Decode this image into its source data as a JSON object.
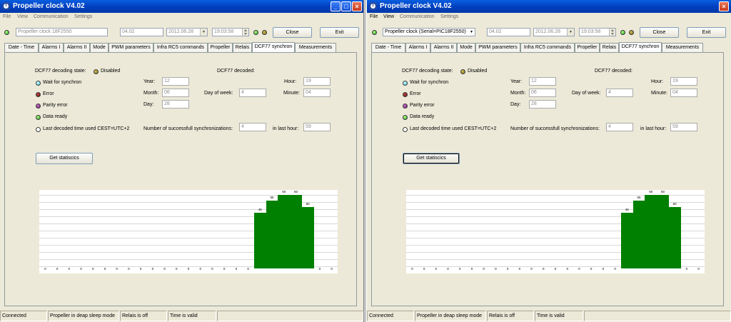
{
  "windows": [
    {
      "title": "Propeller clock V4.02",
      "menu": {
        "file": "File",
        "view": "View",
        "communication": "Communication",
        "settings": "Settings"
      },
      "device": "Propeller clock 18F2550",
      "device_is_dropdown": false,
      "version": "04.02",
      "date": "2012.06.28",
      "time": "19:03:58",
      "close_label": "Close",
      "exit_label": "Exit",
      "tabs": [
        "Date - Time",
        "Alarms I",
        "Alarms II",
        "Mode",
        "PWM parameters",
        "Infra RC5 commands",
        "Propeller",
        "Relais",
        "DCF77 synchron",
        "Measurements"
      ],
      "selected_tab": 8,
      "dcf": {
        "state_label": "DCF77 decoding state:",
        "state_value": "Disabled",
        "decoded_label": "DCF77 decoded:",
        "legend": [
          "Wait for synchron",
          "Error",
          "Parity error",
          "Data ready",
          "Last decoded time used CEST=UTC+2"
        ],
        "year_label": "Year:",
        "year": "12",
        "month_label": "Month:",
        "month": "06",
        "day_label": "Day:",
        "day": "28",
        "dow_label": "Day of week:",
        "dow": "4",
        "hour_label": "Hour:",
        "hour": "19",
        "minute_label": "Minute:",
        "minute": "04",
        "sync_label": "Number of successfull synchronizations:",
        "sync": "4",
        "last_hour_label": "in last hour:",
        "last_hour": "59",
        "stats_button": "Get statiscics",
        "stats_focused": false
      },
      "status": [
        "Connected",
        "Propeller in deap sleep mode",
        "Relais is off",
        "Time is valid"
      ]
    },
    {
      "title": "Propeller clock V4.02",
      "menu": {
        "file": "File",
        "view": "View",
        "communication": "Communication",
        "settings": "Settings"
      },
      "device": "Propeller clock (Serial=PIC18F2550)",
      "device_is_dropdown": true,
      "version": "04.02",
      "date": "2012.06.28",
      "time": "19:03:58",
      "close_label": "Close",
      "exit_label": "Exit",
      "tabs": [
        "Date - Time",
        "Alarms I",
        "Alarms II",
        "Mode",
        "PWM parameters",
        "Infra RC5 commands",
        "Propeller",
        "Relais",
        "DCF77 synchron",
        "Measurements"
      ],
      "selected_tab": 8,
      "dcf": {
        "state_label": "DCF77 decoding state:",
        "state_value": "Disabled",
        "decoded_label": "DCF77 decoded:",
        "legend": [
          "Wait for synchron",
          "Error",
          "Parity error",
          "Data ready",
          "Last decoded time used CEST=UTC+2"
        ],
        "year_label": "Year:",
        "year": "12",
        "month_label": "Month:",
        "month": "06",
        "day_label": "Day:",
        "day": "28",
        "dow_label": "Day of week:",
        "dow": "4",
        "hour_label": "Hour:",
        "hour": "19",
        "minute_label": "Minute:",
        "minute": "04",
        "sync_label": "Number of successfull synchronizations:",
        "sync": "4",
        "last_hour_label": "in last hour:",
        "last_hour": "59",
        "stats_button": "Get statiscics",
        "stats_focused": true
      },
      "status": [
        "Connected",
        "Propeller in deap sleep mode",
        "Relais is off",
        "Time is valid"
      ]
    }
  ],
  "chart_data": [
    {
      "type": "bar",
      "categories": [
        "1",
        "2",
        "3",
        "4",
        "5",
        "6",
        "7",
        "8",
        "9",
        "10",
        "11",
        "12",
        "13",
        "14",
        "15",
        "16",
        "17",
        "18",
        "19",
        "20",
        "21",
        "22",
        "23",
        "24"
      ],
      "values": [
        0,
        0,
        0,
        0,
        0,
        0,
        0,
        0,
        0,
        0,
        0,
        0,
        0,
        0,
        0,
        0,
        0,
        0,
        45,
        55,
        60,
        60,
        50,
        0,
        0
      ],
      "value_labels": [
        "0",
        "0",
        "0",
        "0",
        "0",
        "0",
        "0",
        "0",
        "0",
        "0",
        "0",
        "0",
        "0",
        "0",
        "0",
        "0",
        "0",
        "0",
        "45",
        "55",
        "60",
        "60",
        "50",
        "0",
        "0"
      ],
      "ylim": [
        0,
        60
      ],
      "grid": true,
      "color": "#008000"
    },
    {
      "type": "bar",
      "categories": [
        "1",
        "2",
        "3",
        "4",
        "5",
        "6",
        "7",
        "8",
        "9",
        "10",
        "11",
        "12",
        "13",
        "14",
        "15",
        "16",
        "17",
        "18",
        "19",
        "20",
        "21",
        "22",
        "23",
        "24"
      ],
      "values": [
        0,
        0,
        0,
        0,
        0,
        0,
        0,
        0,
        0,
        0,
        0,
        0,
        0,
        0,
        0,
        0,
        0,
        0,
        45,
        55,
        60,
        60,
        50,
        0,
        0
      ],
      "value_labels": [
        "0",
        "0",
        "0",
        "0",
        "0",
        "0",
        "0",
        "0",
        "0",
        "0",
        "0",
        "0",
        "0",
        "0",
        "0",
        "0",
        "0",
        "0",
        "45",
        "55",
        "60",
        "60",
        "50",
        "0",
        "0"
      ],
      "ylim": [
        0,
        60
      ],
      "grid": true,
      "color": "#008000"
    }
  ]
}
